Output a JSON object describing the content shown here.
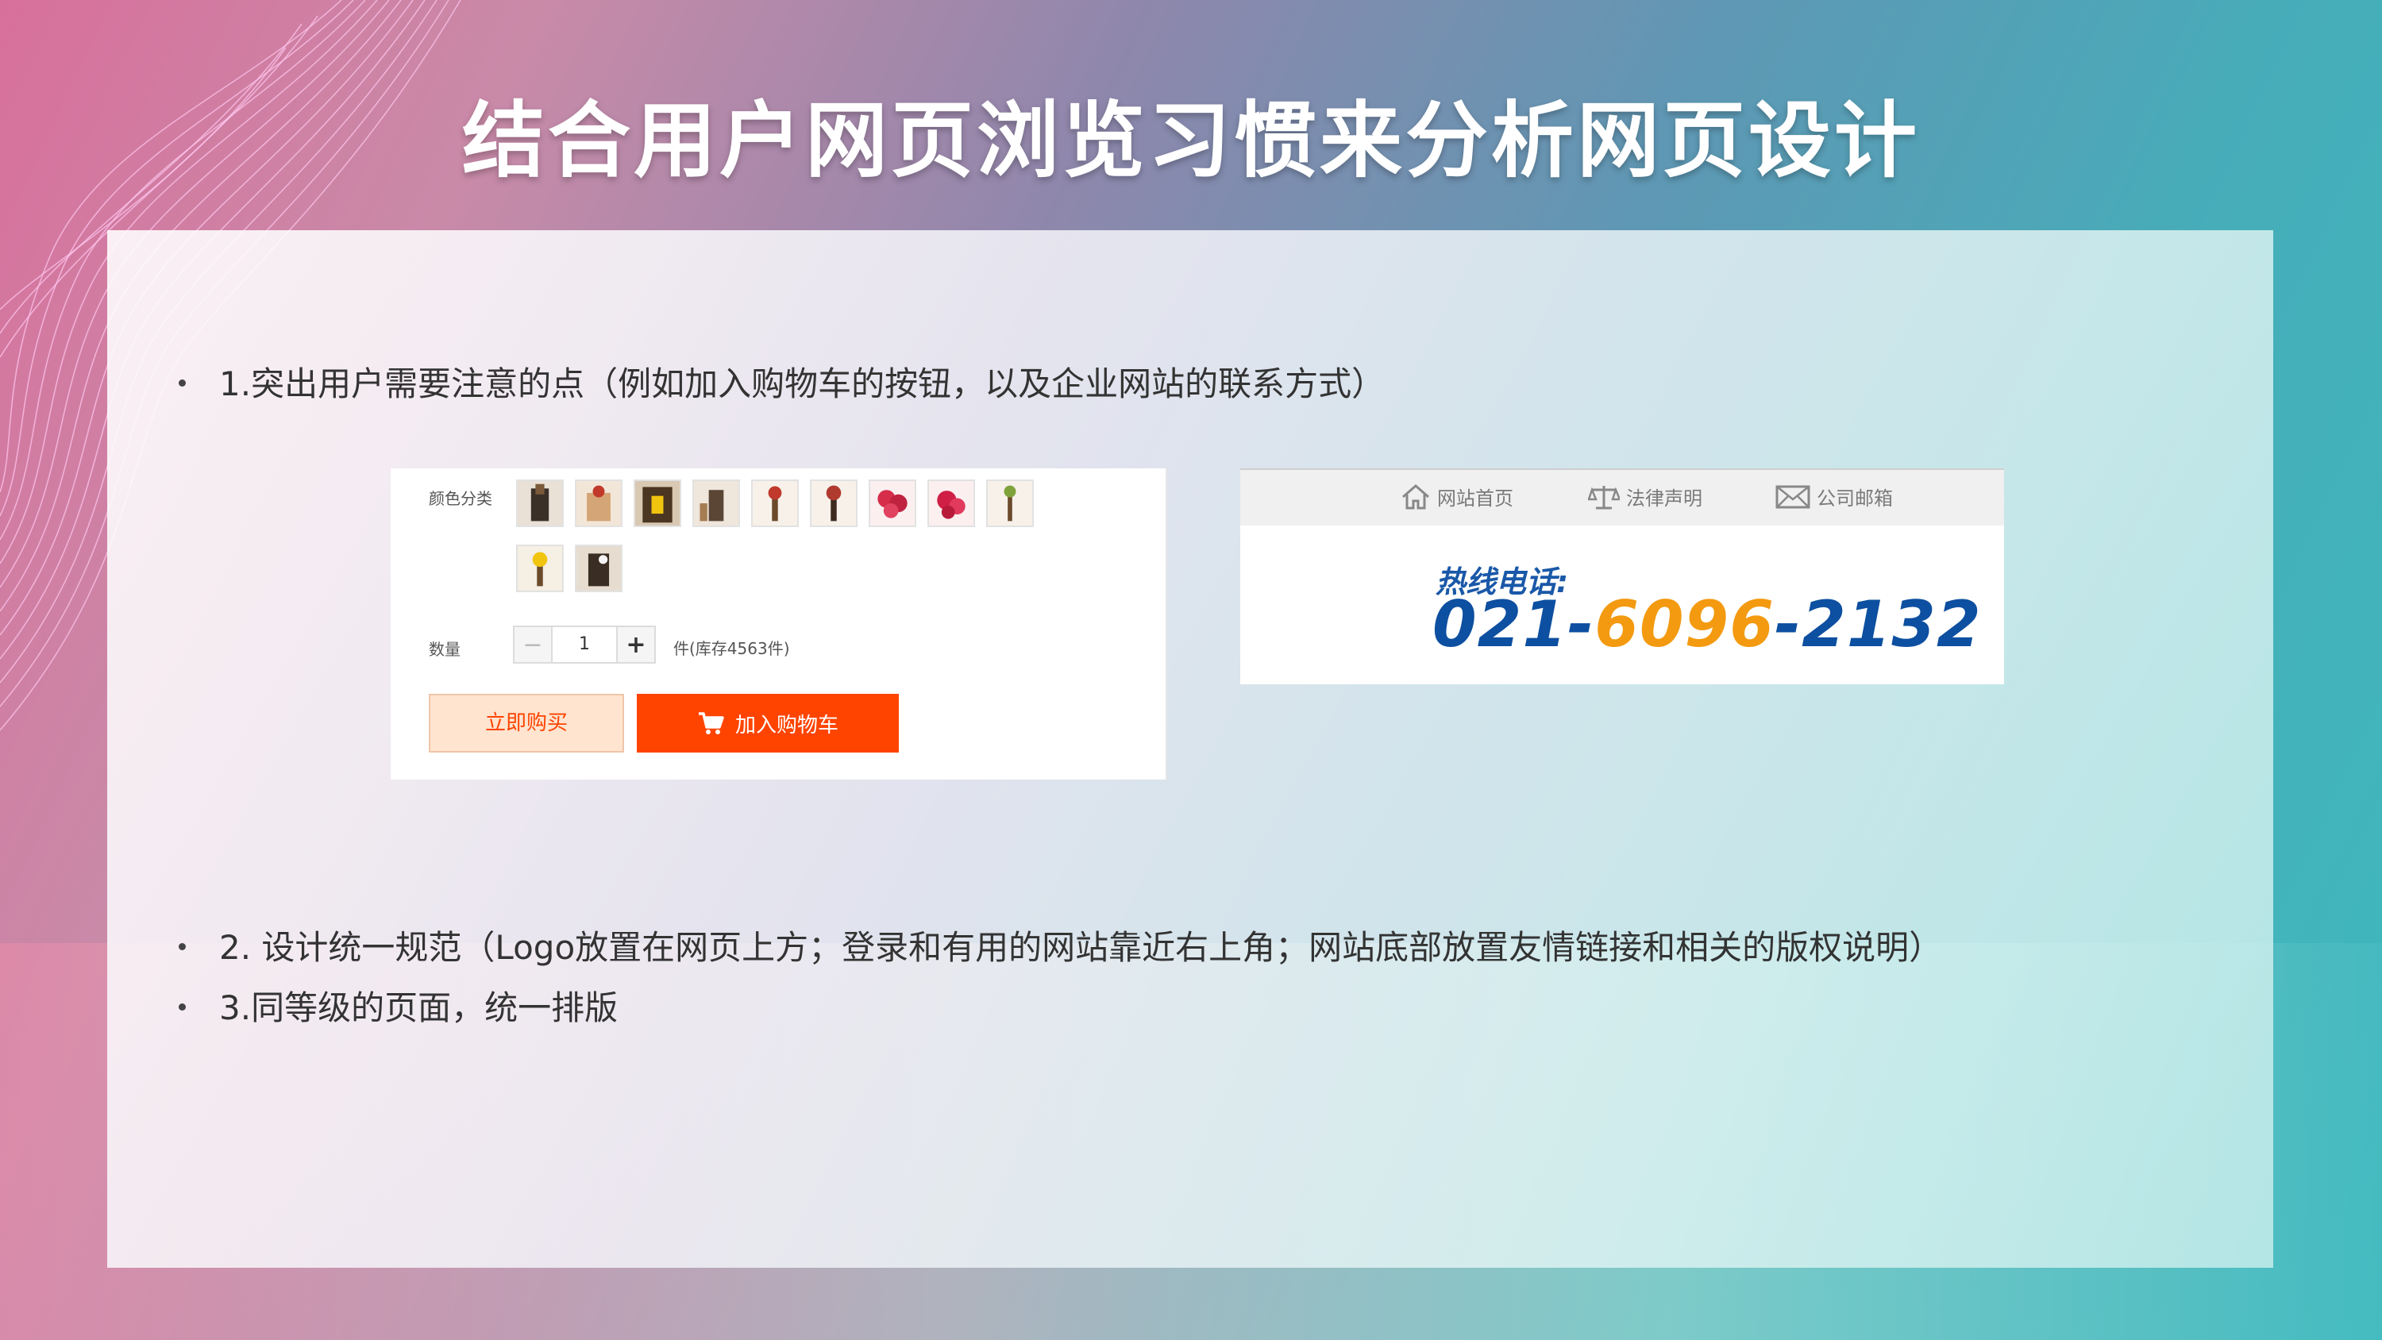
{
  "slide": {
    "title": "结合用户网页浏览习惯来分析网页设计"
  },
  "bullets": [
    "1.突出用户需要注意的点（例如加入购物车的按钮，以及企业网站的联系方式）",
    "2. 设计统一规范（Logo放置在网页上方；登录和有用的网站靠近右上角；网站底部放置友情链接和相关的版权说明）",
    "3.同等级的页面，统一排版"
  ],
  "product_panel": {
    "color_label": "颜色分类",
    "quantity_label": "数量",
    "quantity_value": "1",
    "minus_symbol": "−",
    "plus_symbol": "+",
    "stock_text": "件(库存4563件)",
    "buy_now_label": "立即购买",
    "add_to_cart_label": "加入购物车",
    "thumbnail_count": 11
  },
  "contact_panel": {
    "nav": [
      {
        "label": "网站首页",
        "icon": "home-icon"
      },
      {
        "label": "法律声明",
        "icon": "scale-icon"
      },
      {
        "label": "公司邮箱",
        "icon": "mail-icon"
      }
    ],
    "hotline_label": "热线电话:",
    "phone_part1": "021-",
    "phone_part2": "6096",
    "phone_part3": "-2132"
  },
  "colors": {
    "accent_orange": "#ff4400",
    "phone_blue": "#0d4fa0",
    "phone_orange": "#f39a10"
  }
}
